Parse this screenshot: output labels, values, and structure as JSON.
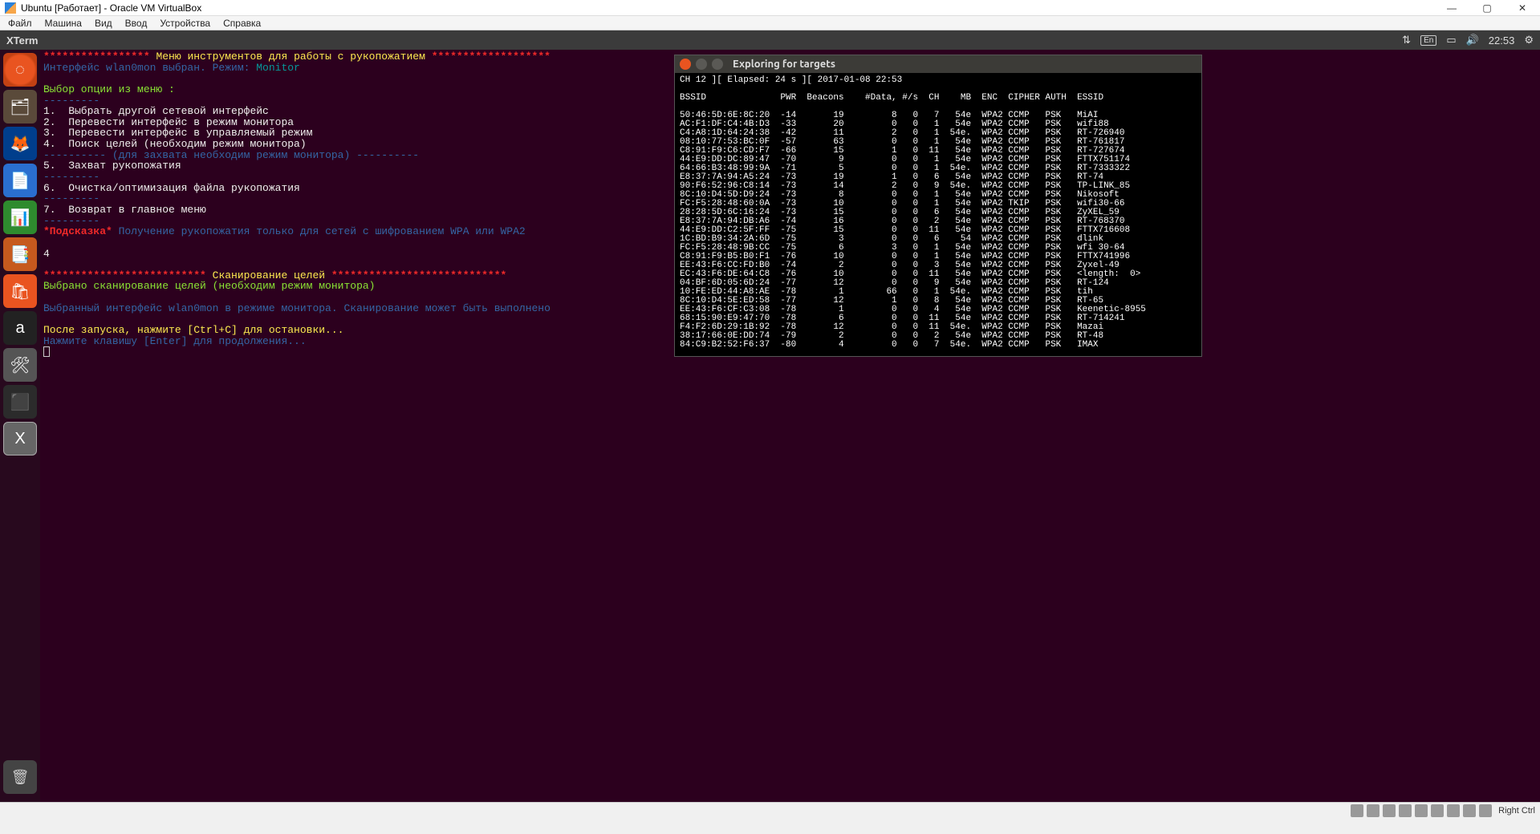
{
  "host": {
    "title": "Ubuntu [Работает] - Oracle VM VirtualBox",
    "menu": [
      "Файл",
      "Машина",
      "Вид",
      "Ввод",
      "Устройства",
      "Справка"
    ],
    "status_right": "Right Ctrl"
  },
  "panel": {
    "app_title": "XTerm",
    "lang": "En",
    "time": "22:53"
  },
  "xterm": {
    "stars1a": "***************** ",
    "banner1": "Меню инструментов для работы с рукопожатием",
    "stars1b": " *******************",
    "iface_line_a": "Интерфейс wlan0mon выбран. Режим: ",
    "iface_line_b": "Monitor",
    "select_prompt": "Выбор опции из меню :",
    "dashes": "---------",
    "opt1": "1.  Выбрать другой сетевой интерфейс",
    "opt2": "2.  Перевести интерфейс в режим монитора",
    "opt3": "3.  Перевести интерфейс в управляемый режим",
    "opt4": "4.  Поиск целей (необходим режим монитора)",
    "sep_mid_a": "---------- ",
    "sep_mid_b": "(для захвата необходим режим монитора)",
    "sep_mid_c": " ----------",
    "opt5": "5.  Захват рукопожатия",
    "opt6": "6.  Очистка/оптимизация файла рукопожатия",
    "opt7": "7.  Возврат в главное меню",
    "hint_star": "*Подсказка*",
    "hint_txt": " Получение рукопожатия только для сетей с шифрованием WPA или WPA2",
    "input": "4",
    "stars2a": "************************** ",
    "banner2": "Сканирование целей",
    "stars2b": " ****************************",
    "chosen": "Выбрано сканирование целей (необходим режим монитора)",
    "iface2": "Выбранный интерфейс wlan0mon в режиме монитора. Сканирование может быть выполнено",
    "after1": "После запуска, нажмите [Ctrl+C] для остановки...",
    "after2": "Нажмите клавишу [Enter] для продолжения..."
  },
  "scan": {
    "title": "Exploring for targets",
    "status": "CH 12 ][ Elapsed: 24 s ][ 2017-01-08 22:53",
    "header": [
      "BSSID",
      "PWR",
      "Beacons",
      "#Data,",
      "#/s",
      "CH",
      "MB",
      "ENC",
      "CIPHER",
      "AUTH",
      "ESSID"
    ],
    "rows": [
      [
        "50:46:5D:6E:8C:20",
        "-14",
        "19",
        "8",
        "0",
        "7",
        "54e",
        "WPA2",
        "CCMP",
        "PSK",
        "MiAI"
      ],
      [
        "AC:F1:DF:C4:4B:D3",
        "-33",
        "20",
        "0",
        "0",
        "1",
        "54e",
        "WPA2",
        "CCMP",
        "PSK",
        "wifi88"
      ],
      [
        "C4:A8:1D:64:24:38",
        "-42",
        "11",
        "2",
        "0",
        "1",
        "54e.",
        "WPA2",
        "CCMP",
        "PSK",
        "RT-726940"
      ],
      [
        "08:10:77:53:BC:0F",
        "-57",
        "63",
        "0",
        "0",
        "1",
        "54e",
        "WPA2",
        "CCMP",
        "PSK",
        "RT-761817"
      ],
      [
        "C8:91:F9:C6:CD:F7",
        "-66",
        "15",
        "1",
        "0",
        "11",
        "54e",
        "WPA2",
        "CCMP",
        "PSK",
        "RT-727674"
      ],
      [
        "44:E9:DD:DC:89:47",
        "-70",
        "9",
        "0",
        "0",
        "1",
        "54e",
        "WPA2",
        "CCMP",
        "PSK",
        "FTTX751174"
      ],
      [
        "64:66:B3:48:99:9A",
        "-71",
        "5",
        "0",
        "0",
        "1",
        "54e.",
        "WPA2",
        "CCMP",
        "PSK",
        "RT-7333322"
      ],
      [
        "E8:37:7A:94:A5:24",
        "-73",
        "19",
        "1",
        "0",
        "6",
        "54e",
        "WPA2",
        "CCMP",
        "PSK",
        "RT-74"
      ],
      [
        "90:F6:52:96:C8:14",
        "-73",
        "14",
        "2",
        "0",
        "9",
        "54e.",
        "WPA2",
        "CCMP",
        "PSK",
        "TP-LINK_85"
      ],
      [
        "8C:10:D4:5D:D9:24",
        "-73",
        "8",
        "0",
        "0",
        "1",
        "54e",
        "WPA2",
        "CCMP",
        "PSK",
        "Nikosoft"
      ],
      [
        "FC:F5:28:48:60:0A",
        "-73",
        "10",
        "0",
        "0",
        "1",
        "54e",
        "WPA2",
        "TKIP",
        "PSK",
        "wifi30-66"
      ],
      [
        "28:28:5D:6C:16:24",
        "-73",
        "15",
        "0",
        "0",
        "6",
        "54e",
        "WPA2",
        "CCMP",
        "PSK",
        "ZyXEL_59"
      ],
      [
        "E8:37:7A:94:DB:A6",
        "-74",
        "16",
        "0",
        "0",
        "2",
        "54e",
        "WPA2",
        "CCMP",
        "PSK",
        "RT-768370"
      ],
      [
        "44:E9:DD:C2:5F:FF",
        "-75",
        "15",
        "0",
        "0",
        "11",
        "54e",
        "WPA2",
        "CCMP",
        "PSK",
        "FTTX716608"
      ],
      [
        "1C:BD:B9:34:2A:6D",
        "-75",
        "3",
        "0",
        "0",
        "6",
        "54",
        "WPA2",
        "CCMP",
        "PSK",
        "dlink"
      ],
      [
        "FC:F5:28:48:9B:CC",
        "-75",
        "6",
        "3",
        "0",
        "1",
        "54e",
        "WPA2",
        "CCMP",
        "PSK",
        "wfi 30-64"
      ],
      [
        "C8:91:F9:B5:B0:F1",
        "-76",
        "10",
        "0",
        "0",
        "1",
        "54e",
        "WPA2",
        "CCMP",
        "PSK",
        "FTTX741996"
      ],
      [
        "EE:43:F6:CC:FD:B0",
        "-74",
        "2",
        "0",
        "0",
        "3",
        "54e",
        "WPA2",
        "CCMP",
        "PSK",
        "Zyxel-49"
      ],
      [
        "EC:43:F6:DE:64:C8",
        "-76",
        "10",
        "0",
        "0",
        "11",
        "54e",
        "WPA2",
        "CCMP",
        "PSK",
        "<length:  0>"
      ],
      [
        "04:BF:6D:05:6D:24",
        "-77",
        "12",
        "0",
        "0",
        "9",
        "54e",
        "WPA2",
        "CCMP",
        "PSK",
        "RT-124"
      ],
      [
        "10:FE:ED:44:A8:AE",
        "-78",
        "1",
        "66",
        "0",
        "1",
        "54e.",
        "WPA2",
        "CCMP",
        "PSK",
        "tih"
      ],
      [
        "8C:10:D4:5E:ED:58",
        "-77",
        "12",
        "1",
        "0",
        "8",
        "54e",
        "WPA2",
        "CCMP",
        "PSK",
        "RT-65"
      ],
      [
        "EE:43:F6:CF:C3:08",
        "-78",
        "1",
        "0",
        "0",
        "4",
        "54e",
        "WPA2",
        "CCMP",
        "PSK",
        "Keenetic-8955"
      ],
      [
        "68:15:90:E9:47:70",
        "-78",
        "6",
        "0",
        "0",
        "11",
        "54e",
        "WPA2",
        "CCMP",
        "PSK",
        "RT-714241"
      ],
      [
        "F4:F2:6D:29:1B:92",
        "-78",
        "12",
        "0",
        "0",
        "11",
        "54e.",
        "WPA2",
        "CCMP",
        "PSK",
        "Mazai"
      ],
      [
        "38:17:66:0E:DD:74",
        "-79",
        "2",
        "0",
        "0",
        "2",
        "54e",
        "WPA2",
        "CCMP",
        "PSK",
        "RT-48"
      ],
      [
        "84:C9:B2:52:F6:37",
        "-80",
        "4",
        "0",
        "0",
        "7",
        "54e.",
        "WPA2",
        "CCMP",
        "PSK",
        "IMAX"
      ]
    ]
  }
}
